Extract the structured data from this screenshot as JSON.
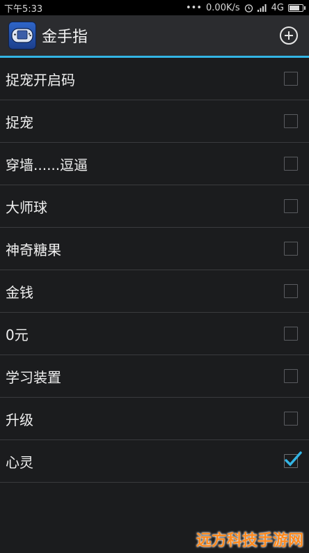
{
  "status_bar": {
    "time": "下午5:33",
    "network_speed": "0.00K/s",
    "network_type": "4G",
    "battery_percent": 80
  },
  "action_bar": {
    "title": "金手指",
    "app_icon": "gameboy-advance-icon",
    "add_icon": "circle-plus-icon"
  },
  "cheats": [
    {
      "label": "捉宠开启码",
      "checked": false
    },
    {
      "label": "捉宠",
      "checked": false
    },
    {
      "label": "穿墙......逗逼",
      "checked": false
    },
    {
      "label": "大师球",
      "checked": false
    },
    {
      "label": "神奇糖果",
      "checked": false
    },
    {
      "label": "金钱",
      "checked": false
    },
    {
      "label": "0元",
      "checked": false
    },
    {
      "label": "学习装置",
      "checked": false
    },
    {
      "label": "升级",
      "checked": false
    },
    {
      "label": "心灵",
      "checked": true
    }
  ],
  "colors": {
    "accent": "#33b5e5",
    "check": "#33b5e5",
    "background": "#1b1c1e"
  },
  "watermark": "远方科技手游网"
}
